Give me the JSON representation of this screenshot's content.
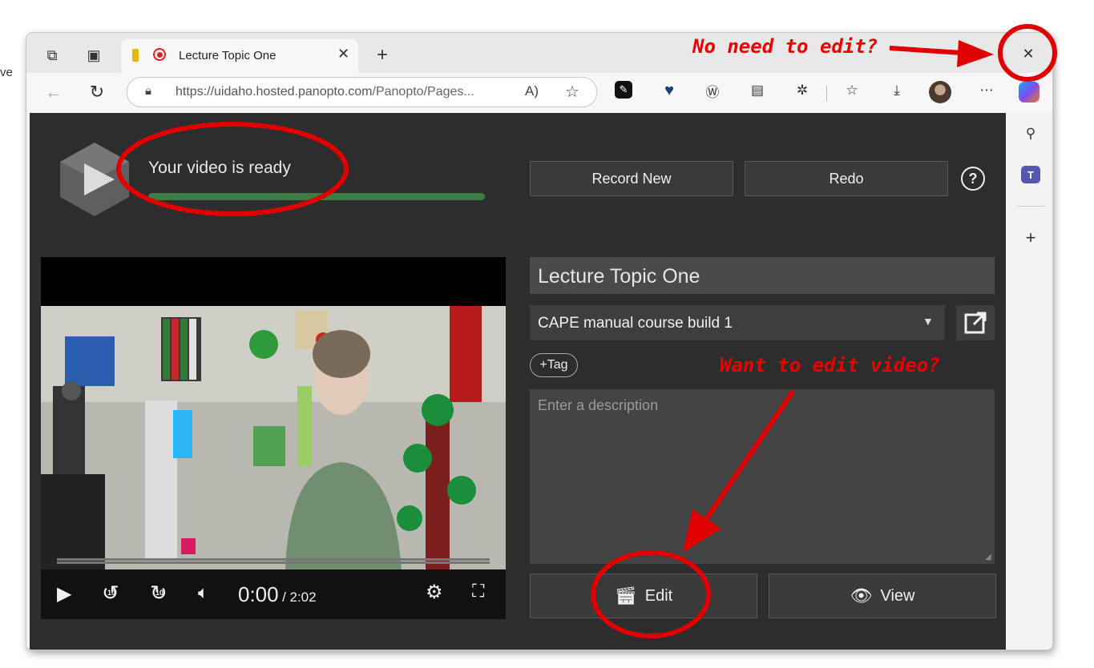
{
  "browser": {
    "tab": {
      "title": "Lecture Topic One"
    },
    "address": {
      "url_host": "https://uidaho.hosted.panopto.com",
      "url_path": "/Panopto/Pages..."
    },
    "edge_left_text": "ve"
  },
  "header": {
    "status_text": "Your video is ready",
    "progress": 1.0,
    "record_new_label": "Record New",
    "redo_label": "Redo"
  },
  "player": {
    "current_time": "0:00",
    "duration": "/ 2:02",
    "skip_back_label": "10",
    "skip_forward_label": "10"
  },
  "form": {
    "title_value": "Lecture Topic One",
    "folder_value": "CAPE manual course build 1",
    "tag_label": "+Tag",
    "description_placeholder": "Enter a description",
    "edit_label": "Edit",
    "view_label": "View"
  },
  "annotations": {
    "close_callout": "No need to edit?",
    "edit_callout": "Want to edit video?"
  },
  "colors": {
    "accent_red": "#e00000",
    "progress_green": "#3d7d45",
    "panel_dark": "#2d2d2d"
  }
}
